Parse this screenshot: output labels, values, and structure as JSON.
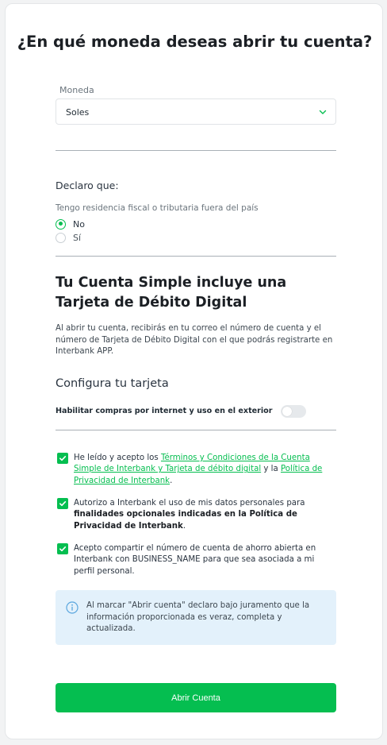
{
  "header": {
    "title": "¿En qué moneda deseas abrir tu cuenta?"
  },
  "currency": {
    "label": "Moneda",
    "value": "Soles"
  },
  "declaration": {
    "heading": "Declaro que:",
    "question": "Tengo residencia fiscal o tributaria fuera del país",
    "options": [
      {
        "label": "No",
        "selected": true
      },
      {
        "label": "Sí",
        "selected": false
      }
    ]
  },
  "card_section": {
    "title": "Tu Cuenta Simple incluye una Tarjeta de Débito Digital",
    "description": "Al abrir tu cuenta, recibirás en tu correo el número de cuenta y el número de Tarjeta de Débito Digital con el que podrás registrarte en Interbank APP.",
    "configure_title": "Configura tu tarjeta",
    "toggle_label": "Habilitar compras por internet y uso en el exterior",
    "toggle_on": false
  },
  "consents": {
    "terms": {
      "prefix": "He leído y acepto los ",
      "link1": "Términos y Condiciones de la Cuenta Simple de Interbank y Tarjeta de débito digital",
      "middle": " y la ",
      "link2": "Política de Privacidad de Interbank",
      "suffix": ".",
      "checked": true
    },
    "personal_data": {
      "prefix": "Autorizo a Interbank el uso de mis datos personales para ",
      "bold": "finalidades opcionales indicadas en la Política de Privacidad de Interbank",
      "suffix": ".",
      "checked": true
    },
    "share_account": {
      "text": "Acepto compartir el número de cuenta de ahorro abierta en Interbank con BUSINESS_NAME para que sea asociada a mi perfil personal.",
      "checked": true
    }
  },
  "info_box": {
    "text": "Al marcar \"Abrir cuenta\" declaro bajo juramento que la información proporcionada es veraz, completa y actualizada."
  },
  "actions": {
    "submit_label": "Abrir Cuenta"
  },
  "colors": {
    "accent": "#05be50",
    "info_bg": "#e3f1fb",
    "info_icon": "#5aa6de"
  }
}
